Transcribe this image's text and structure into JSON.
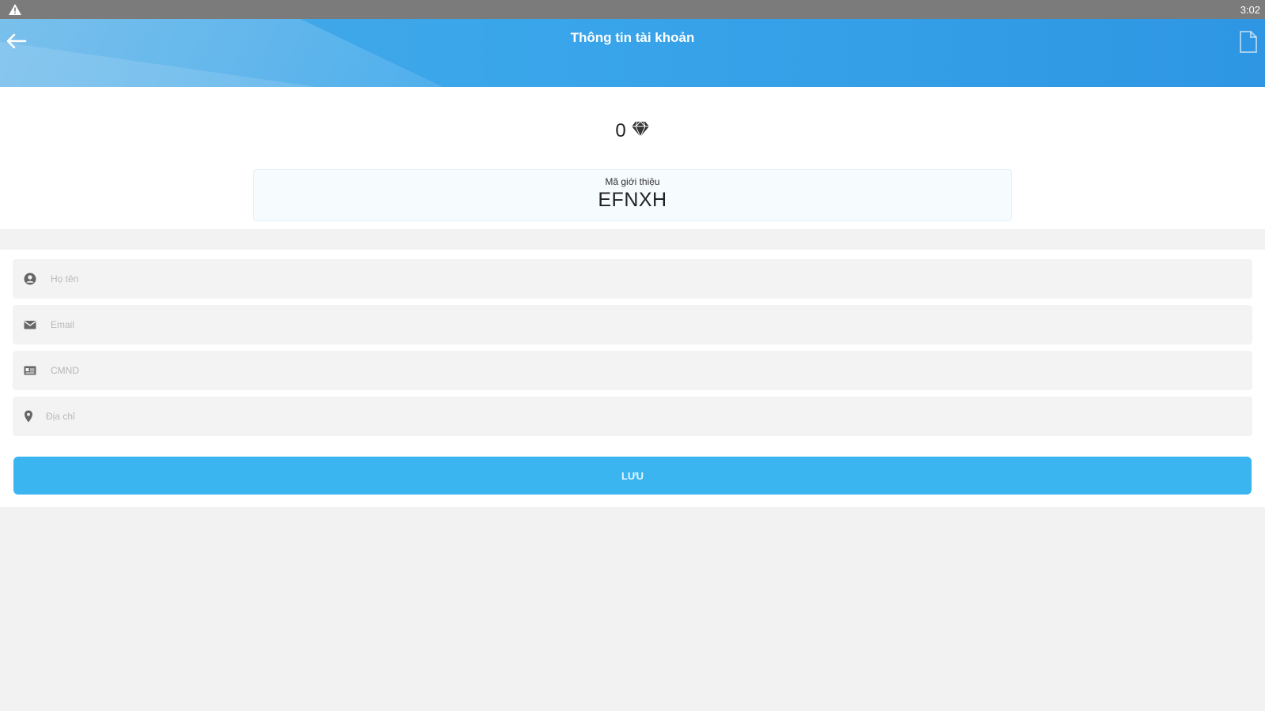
{
  "status_bar": {
    "time": "3:02",
    "warning_icon": "warning-triangle-icon"
  },
  "app_bar": {
    "title": "Thông tin tài khoản",
    "back_icon": "arrow-left-icon",
    "action_icon": "document-icon",
    "colors": {
      "start": "#48a9e6",
      "end": "#2e96e3"
    }
  },
  "account": {
    "points": "0",
    "points_icon": "diamond-icon",
    "referral_label": "Mã giới thiệu",
    "referral_code": "EFNXH"
  },
  "form": {
    "fields": [
      {
        "icon": "person-icon",
        "placeholder": "Họ tên",
        "value": ""
      },
      {
        "icon": "email-icon",
        "placeholder": "Email",
        "value": ""
      },
      {
        "icon": "id-card-icon",
        "placeholder": "CMND",
        "value": ""
      },
      {
        "icon": "location-pin-icon",
        "placeholder": "Địa chỉ",
        "value": ""
      }
    ],
    "save_label": "LƯU",
    "accent_color": "#3bb5f0"
  }
}
